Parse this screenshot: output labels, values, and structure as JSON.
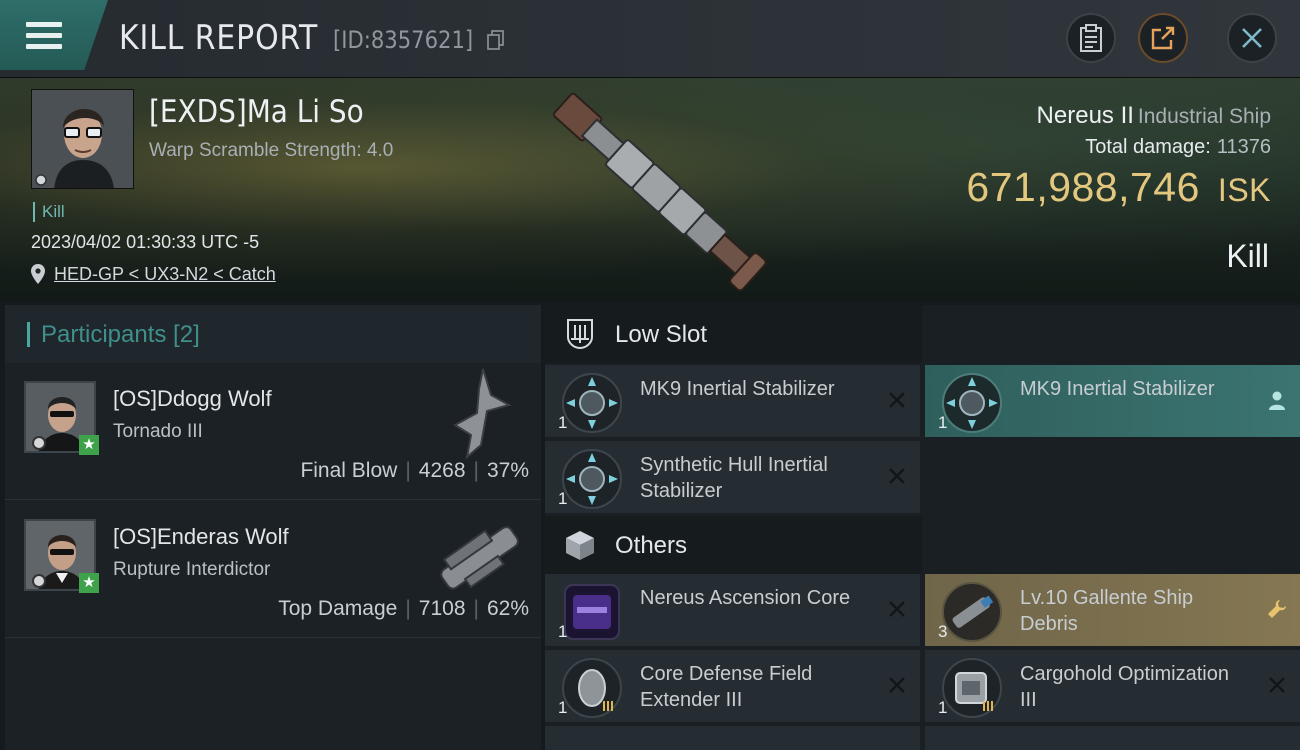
{
  "header": {
    "title": "KILL REPORT",
    "report_id": "[ID:8357621]"
  },
  "victim": {
    "name": "[EXDS]Ma Li So",
    "warp_scramble": "Warp Scramble Strength: 4.0",
    "kill_tag": "Kill",
    "datetime": "2023/04/02 01:30:33 UTC -5",
    "location": "HED-GP < UX3-N2 < Catch"
  },
  "ship": {
    "name": "Nereus II",
    "class": "Industrial Ship",
    "total_damage_label": "Total damage:",
    "total_damage_value": "11376",
    "isk_value": "671,988,746",
    "isk_unit": "ISK",
    "status": "Kill"
  },
  "participants": {
    "label": "Participants [2]",
    "items": [
      {
        "name": "[OS]Ddogg Wolf",
        "ship": "Tornado III",
        "role": "Final Blow",
        "damage": "4268",
        "percent": "37%"
      },
      {
        "name": "[OS]Enderas Wolf",
        "ship": "Rupture Interdictor",
        "role": "Top Damage",
        "damage": "7108",
        "percent": "62%"
      }
    ]
  },
  "sections": {
    "low_slot": "Low Slot",
    "others": "Others"
  },
  "low_slot_items": [
    {
      "qty": "1",
      "name": "MK9 Inertial Stabilizer"
    },
    {
      "qty": "1",
      "name": "MK9 Inertial Stabilizer"
    },
    {
      "qty": "1",
      "name": "Synthetic Hull Inertial Stabilizer"
    }
  ],
  "other_items": [
    {
      "qty": "1",
      "name": "Nereus Ascension Core"
    },
    {
      "qty": "3",
      "name": "Lv.10 Gallente Ship Debris"
    },
    {
      "qty": "1",
      "name": "Core Defense Field Extender III"
    },
    {
      "qty": "1",
      "name": "Cargohold Optimization III"
    }
  ],
  "colors": {
    "accent_teal": "#3b7471",
    "isk_gold": "#e3c77f",
    "destroyed_gold": "#857752"
  }
}
